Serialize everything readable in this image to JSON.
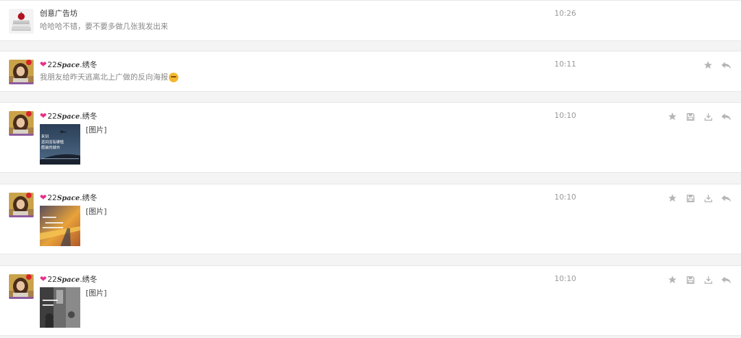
{
  "colors": {
    "page_bg": "#f4f4f4",
    "card_bg": "#ffffff",
    "icon_gray": "#b5b5b5",
    "heart": "#e8308a"
  },
  "messages": [
    {
      "sender": "创意广告坊",
      "avatar": "stacked-books-apple-avatar",
      "preview": "哈哈哈不错，要不要多做几张我发出来",
      "time": "10:26",
      "actions": []
    },
    {
      "sender_prefix": "22",
      "sender_space": "Space",
      "sender_suffix": ".绣冬",
      "avatar": "woman-portrait-avatar",
      "preview": "我朋友给昨天逃离北上广做的反向海报",
      "preview_emoji": "smirk-emoji",
      "time": "10:11",
      "actions": [
        "star-icon",
        "reply-icon"
      ]
    },
    {
      "sender_prefix": "22",
      "sender_space": "Space",
      "sender_suffix": ".绣冬",
      "avatar": "woman-portrait-avatar",
      "image_label": "[图片]",
      "thumb_text": [
        "来到",
        "道间没有硬植",
        "假装的城市"
      ],
      "time": "10:10",
      "actions": [
        "star-icon",
        "save-icon",
        "download-icon",
        "reply-icon"
      ]
    },
    {
      "sender_prefix": "22",
      "sender_space": "Space",
      "sender_suffix": ".绣冬",
      "avatar": "woman-portrait-avatar",
      "image_label": "[图片]",
      "time": "10:10",
      "actions": [
        "star-icon",
        "save-icon",
        "download-icon",
        "reply-icon"
      ]
    },
    {
      "sender_prefix": "22",
      "sender_space": "Space",
      "sender_suffix": ".绣冬",
      "avatar": "woman-portrait-avatar",
      "image_label": "[图片]",
      "time": "10:10",
      "actions": [
        "star-icon",
        "save-icon",
        "download-icon",
        "reply-icon"
      ]
    }
  ]
}
